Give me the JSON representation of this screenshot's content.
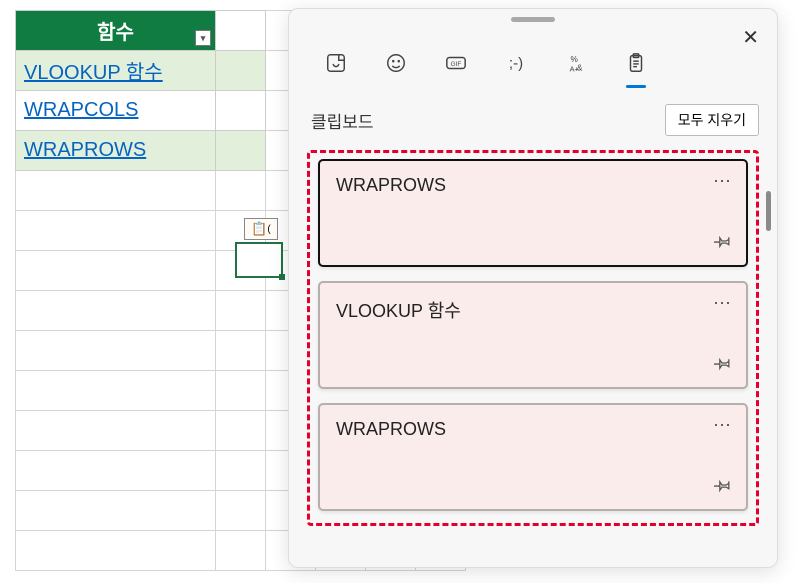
{
  "sheet": {
    "header": "함수",
    "rows": [
      {
        "text": "VLOOKUP 함수",
        "link": true,
        "bg": "pale-even"
      },
      {
        "text": "WRAPCOLS",
        "link": true,
        "bg": "pale-odd"
      },
      {
        "text": "WRAPROWS",
        "link": true,
        "bg": "pale-even"
      }
    ]
  },
  "paste_options_label": "📋(",
  "clipboard": {
    "title": "클립보드",
    "clear_all": "모두 지우기",
    "items": [
      {
        "text": "WRAPROWS"
      },
      {
        "text": "VLOOKUP 함수"
      },
      {
        "text": "WRAPROWS"
      }
    ]
  }
}
